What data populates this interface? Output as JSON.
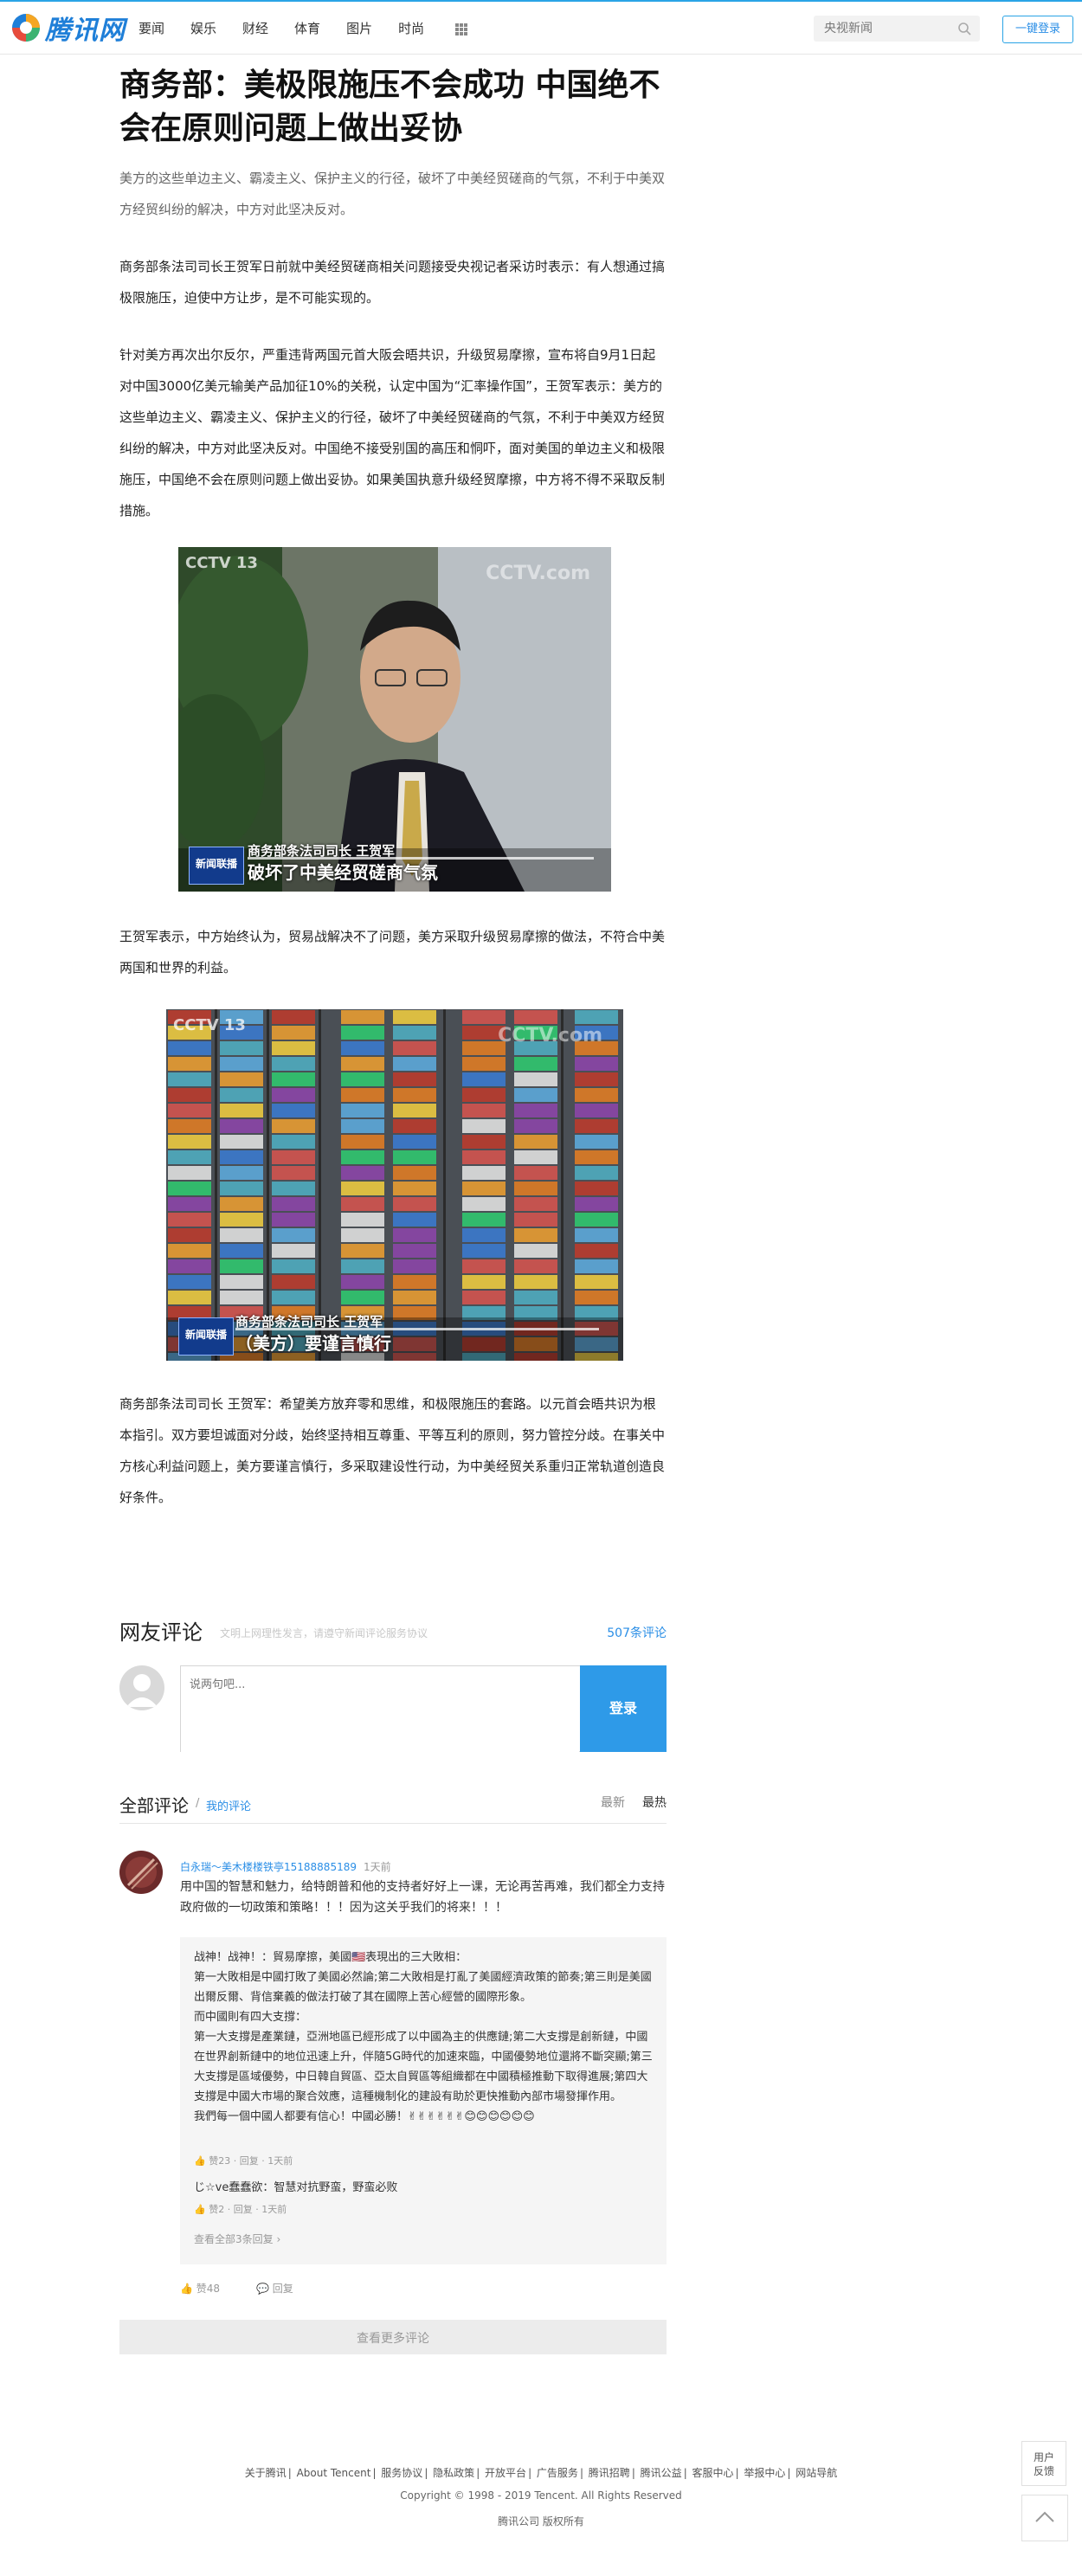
{
  "header": {
    "logo_text": "腾讯网",
    "nav": [
      "要闻",
      "娱乐",
      "财经",
      "体育",
      "图片",
      "时尚"
    ],
    "search_placeholder": "央视新闻",
    "login_label": "一键登录"
  },
  "article": {
    "title": "商务部：美极限施压不会成功 中国绝不会在原则问题上做出妥协",
    "lead": "美方的这些单边主义、霸凌主义、保护主义的行径，破坏了中美经贸磋商的气氛，不利于中美双方经贸纠纷的解决，中方对此坚决反对。",
    "paragraphs": [
      "商务部条法司司长王贺军日前就中美经贸磋商相关问题接受央视记者采访时表示：有人想通过搞极限施压，迫使中方让步，是不可能实现的。",
      "针对美方再次出尔反尔，严重违背两国元首大阪会晤共识，升级贸易摩擦，宣布将自9月1日起对中国3000亿美元输美产品加征10%的关税，认定中国为“汇率操作国”，王贺军表示：美方的这些单边主义、霸凌主义、保护主义的行径，破坏了中美经贸磋商的气氛，不利于中美双方经贸纠纷的解决，中方对此坚决反对。中国绝不接受别国的高压和恫吓，面对美国的单边主义和极限施压，中国绝不会在原则问题上做出妥协。如果美国执意升级经贸摩擦，中方将不得不采取反制措施。",
      "王贺军表示，中方始终认为，贸易战解决不了问题，美方采取升级贸易摩擦的做法，不符合中美两国和世界的利益。",
      "商务部条法司司长 王贺军：希望美方放弃零和思维，和极限施压的套路。以元首会晤共识为根本指引。双方要坦诚面对分歧，始终坚持相互尊重、平等互利的原则，努力管控分歧。在事关中方核心利益问题上，美方要谨言慎行，多采取建设性行动，为中美经贸关系重归正常轨道创造良好条件。"
    ],
    "figures": [
      {
        "channel": "CCTV 13",
        "watermark": "CCTV.com",
        "badge": "新闻联播",
        "caption_name": "商务部条法司司长 王贺军",
        "caption_quote": "破坏了中美经贸磋商气氛"
      },
      {
        "channel": "CCTV 13",
        "watermark": "CCTV.com",
        "badge": "新闻联播",
        "caption_name": "商务部条法司司长 王贺军",
        "caption_quote": "（美方）要谨言慎行"
      }
    ]
  },
  "comments": {
    "title": "网友评论",
    "hint": "文明上网理性发言，请遵守新闻评论服务协议",
    "count": "507条评论",
    "input_placeholder": "说两句吧...",
    "submit_label": "登录",
    "all_title": "全部评论",
    "separator": "/",
    "my_comments": "我的评论",
    "sort_latest": "最新",
    "sort_hot": "最热",
    "items": [
      {
        "user": "白永瑞～美木楼楼铁亭15188885189",
        "time": "1天前",
        "text": "用中国的智慧和魅力，给特朗普和他的支持者好好上一课，无论再苦再难，我们都全力支持政府做的一切政策和策略！！！因为这关乎我们的将来！！！",
        "replies": [
          {
            "text_lines": [
              "战神！战神！：貿易摩擦，美國🇺🇸表現出的三大敗相：",
              "第一大敗相是中國打敗了美國必然論;第二大敗相是打亂了美國經濟政策的節奏;第三則是美國出爾反爾、背信棄義的做法打破了其在國際上苦心經營的國際形象。",
              "而中國則有四大支撐：",
              "第一大支撐是產業鏈，亞洲地區已經形成了以中國為主的供應鏈;第二大支撐是創新鏈，中國在世界創新鏈中的地位迅速上升，伴隨5G時代的加速來臨，中國優勢地位還將不斷突顯;第三大支撐是區域優勢，中日韓自貿區、亞太自貿區等組織都在中國積極推動下取得進展;第四大支撐是中國大市場的聚合效應，這種機制化的建設有助於更快推動內部市場發揮作用。",
              "我們每一個中國人都要有信心！中國必勝！✌✌✌✌✌✌😊😊😊😊😊😊"
            ],
            "likes": "赞23",
            "reply_label": "回复",
            "time": "1天前"
          },
          {
            "text": "じ☆ve蠢蠢欲：智慧对抗野蛮，野蛮必败",
            "likes": "赞2",
            "reply_label": "回复",
            "time": "1天前"
          }
        ],
        "more_replies": "查看全部3条回复 ›",
        "likes": "赞48",
        "reply_label": "回复"
      }
    ],
    "view_more": "查看更多评论"
  },
  "footer": {
    "links": [
      "关于腾讯",
      "About Tencent",
      "服务协议",
      "隐私政策",
      "开放平台",
      "广告服务",
      "腾讯招聘",
      "腾讯公益",
      "客服中心",
      "举报中心",
      "网站导航"
    ],
    "copyright": "Copyright © 1998 - 2019 Tencent. All Rights Reserved",
    "company": "腾讯公司 版权所有"
  },
  "floating": {
    "feedback_line1": "用户",
    "feedback_line2": "反馈"
  },
  "colors": {
    "accent": "#2a8ee6",
    "submit_bg": "#2e9ae8",
    "reply_bg": "#f5f5f5"
  }
}
